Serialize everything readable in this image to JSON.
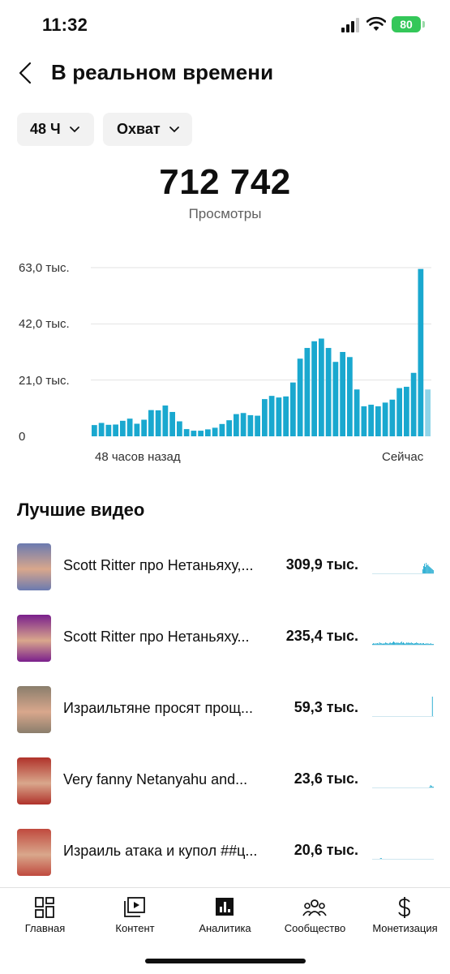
{
  "status": {
    "time": "11:32",
    "battery": "80"
  },
  "header": {
    "title": "В реальном времени"
  },
  "filters": {
    "period": "48 Ч",
    "metric": "Охват"
  },
  "summary": {
    "total": "712 742",
    "label": "Просмотры"
  },
  "chart_data": {
    "type": "bar",
    "yticks": [
      "63,0 тыс.",
      "42,0 тыс.",
      "21,0 тыс.",
      "0"
    ],
    "ylim": [
      0,
      63000
    ],
    "xlabels": {
      "start": "48 часов назад",
      "end": "Сейчас"
    },
    "values": [
      4200,
      5000,
      4300,
      4400,
      5800,
      6600,
      4700,
      6200,
      9800,
      9700,
      11500,
      9100,
      5600,
      2700,
      2100,
      2100,
      2600,
      3200,
      4600,
      6000,
      8300,
      8700,
      7900,
      7700,
      13900,
      15100,
      14500,
      14900,
      20100,
      29000,
      33000,
      35500,
      36500,
      33000,
      27800,
      31500,
      29600,
      17500,
      11200,
      11800,
      11200,
      12600,
      13700,
      18000,
      18500,
      23700,
      62500,
      17500
    ],
    "current_partial_index": 47,
    "color": "#1aa8cf",
    "partial_color": "#8fd4e8",
    "grid": true
  },
  "videos_section": {
    "title": "Лучшие видео"
  },
  "videos": [
    {
      "title": "Scott Ritter про Нетаньяху,...",
      "views": "309,9 тыс.",
      "thumb_bg": "#6b7ab0",
      "spark": [
        0,
        0,
        0,
        0,
        0,
        0,
        0,
        0,
        0,
        0,
        0,
        0,
        0,
        0,
        0,
        0,
        0,
        0,
        0,
        0,
        0,
        0,
        0,
        0,
        0,
        0,
        0,
        0,
        0,
        0,
        0,
        0,
        0,
        0,
        0,
        0,
        0,
        0,
        0,
        0,
        0,
        0,
        0,
        0,
        0,
        0,
        0,
        0,
        0,
        0,
        0,
        0,
        0,
        0,
        0,
        0,
        0,
        5,
        9,
        12,
        8,
        13,
        10,
        11,
        9,
        8,
        7,
        6,
        5,
        4
      ]
    },
    {
      "title": "Scott Ritter про Нетаньяху...",
      "views": "235,4 тыс.",
      "thumb_bg": "#7a1f8c",
      "spark": [
        1,
        2,
        1,
        2,
        1,
        2,
        2,
        1,
        3,
        2,
        2,
        1,
        2,
        1,
        2,
        3,
        2,
        2,
        1,
        2,
        3,
        2,
        2,
        3,
        4,
        3,
        2,
        3,
        2,
        3,
        2,
        2,
        3,
        4,
        2,
        3,
        2,
        1,
        2,
        3,
        2,
        3,
        2,
        2,
        3,
        2,
        2,
        1,
        2,
        2,
        3,
        2,
        2,
        1,
        2,
        2,
        1,
        2,
        2,
        1,
        1,
        2,
        1,
        2,
        1,
        1,
        2,
        1,
        1,
        1
      ]
    },
    {
      "title": "Израильтяне просят прощ...",
      "views": "59,3 тыс.",
      "thumb_bg": "#8a7e6c",
      "spark": [
        0,
        0,
        0,
        0,
        0,
        0,
        0,
        0,
        0,
        0,
        0,
        0,
        0,
        0,
        0,
        0,
        0,
        0,
        0,
        0,
        0,
        0,
        0,
        0,
        0,
        0,
        0,
        0,
        0,
        0,
        0,
        0,
        0,
        0,
        0,
        0,
        0,
        0,
        0,
        0,
        0,
        0,
        0,
        0,
        0,
        0,
        0,
        0,
        0,
        0,
        0,
        0,
        0,
        0,
        0,
        0,
        0,
        0,
        0,
        0,
        0,
        0,
        0,
        0,
        0,
        0,
        0,
        0,
        24,
        0
      ]
    },
    {
      "title": "Very fanny  Netanyahu and...",
      "views": "23,6 тыс.",
      "thumb_bg": "#b0322a",
      "spark": [
        0,
        0,
        0,
        0,
        0,
        0,
        0,
        0,
        0,
        0,
        0,
        0,
        0,
        0,
        0,
        0,
        0,
        0,
        0,
        0,
        0,
        0,
        0,
        0,
        0,
        0,
        0,
        0,
        0,
        0,
        0,
        0,
        0,
        0,
        0,
        0,
        0,
        0,
        0,
        0,
        0,
        0,
        0,
        0,
        0,
        0,
        0,
        0,
        0,
        0,
        0,
        0,
        0,
        0,
        0,
        0,
        0,
        0,
        0,
        0,
        0,
        0,
        0,
        0,
        0,
        1,
        3,
        2,
        1,
        1
      ]
    },
    {
      "title": "Израиль атака и купол ##ц...",
      "views": "20,6 тыс.",
      "thumb_bg": "#c04a3e",
      "spark": [
        0,
        0,
        0,
        0,
        0,
        0,
        0,
        0,
        0,
        1,
        1,
        0,
        0,
        0,
        0,
        0,
        0,
        0,
        0,
        0,
        0,
        0,
        0,
        0,
        0,
        0,
        0,
        0,
        0,
        0,
        0,
        0,
        0,
        0,
        0,
        0,
        0,
        0,
        0,
        0,
        0,
        0,
        0,
        0,
        0,
        0,
        0,
        0,
        0,
        0,
        0,
        0,
        0,
        0,
        0,
        0,
        0,
        0,
        0,
        0,
        0,
        0,
        0,
        0,
        0,
        0,
        0,
        0,
        0,
        0
      ]
    }
  ],
  "nav": [
    {
      "label": "Главная",
      "icon": "home-grid-icon"
    },
    {
      "label": "Контент",
      "icon": "content-icon"
    },
    {
      "label": "Аналитика",
      "icon": "analytics-icon"
    },
    {
      "label": "Сообщество",
      "icon": "community-icon"
    },
    {
      "label": "Монетизация",
      "icon": "dollar-icon"
    }
  ]
}
